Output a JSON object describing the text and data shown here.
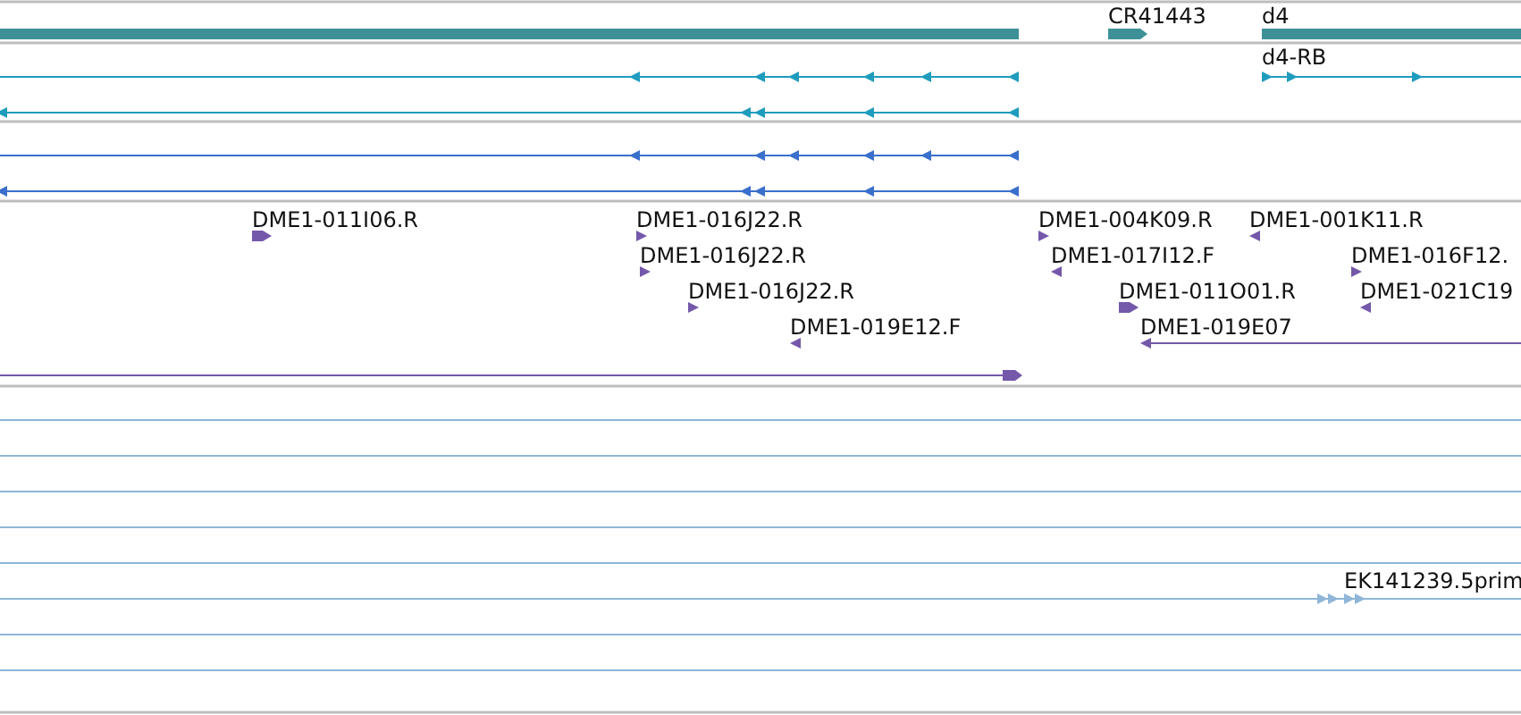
{
  "genes": [
    {
      "label": "CR41443",
      "reverse": false
    },
    {
      "label": "d4",
      "reverse": false
    }
  ],
  "transcripts": [
    {
      "label": "d4-RB",
      "reverse": false
    }
  ],
  "reads": [
    {
      "label": "DME1-011I06.R",
      "reverse": false
    },
    {
      "label": "DME1-016J22.R",
      "reverse": false
    },
    {
      "label": "DME1-016J22.R",
      "reverse": false
    },
    {
      "label": "DME1-016J22.R",
      "reverse": false
    },
    {
      "label": "DME1-019E12.F",
      "reverse": true
    },
    {
      "label": "DME1-004K09.R",
      "reverse": false
    },
    {
      "label": "DME1-017I12.F",
      "reverse": true
    },
    {
      "label": "DME1-011O01.R",
      "reverse": false
    },
    {
      "label": "DME1-019E07",
      "reverse": true
    },
    {
      "label": "DME1-001K11.R",
      "reverse": true
    },
    {
      "label": "DME1-016F12.",
      "reverse": false
    },
    {
      "label": "DME1-021C19",
      "reverse": true
    }
  ],
  "primers": [
    {
      "label": "EK141239.5prim",
      "reverse": false
    }
  ]
}
